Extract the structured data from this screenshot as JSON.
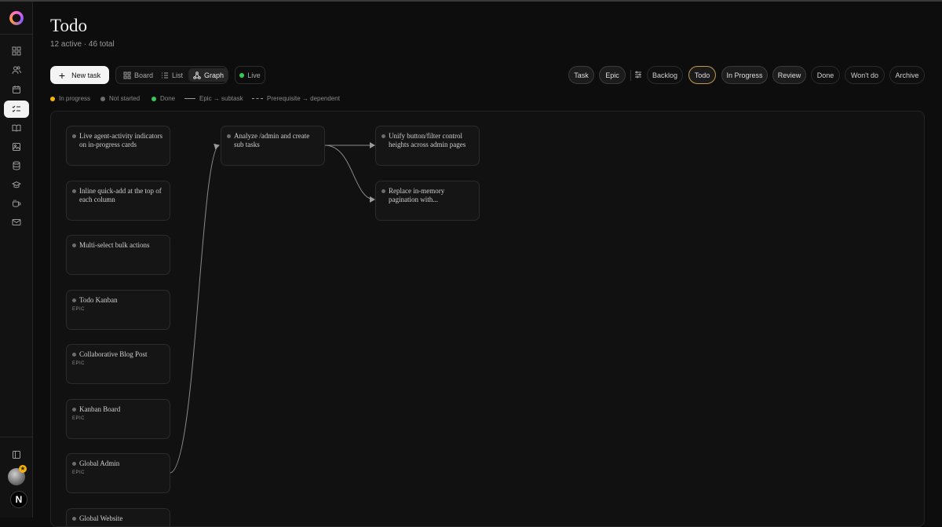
{
  "page": {
    "title": "Todo",
    "subtitle": "12 active · 46 total"
  },
  "sidebar": {
    "items": [
      {
        "icon": "dashboard-icon"
      },
      {
        "icon": "users-icon"
      },
      {
        "icon": "calendar-icon"
      },
      {
        "icon": "tasks-icon",
        "active": true
      },
      {
        "icon": "book-icon"
      },
      {
        "icon": "image-icon"
      },
      {
        "icon": "database-icon"
      },
      {
        "icon": "graduation-cap-icon"
      },
      {
        "icon": "coffee-cup-icon"
      },
      {
        "icon": "mail-icon"
      }
    ],
    "bottom": {
      "icon": "sidebar-toggle-icon",
      "avatar_badge": "★",
      "brand_letter": "N"
    }
  },
  "toolbar": {
    "new_task_label": "New task",
    "views": [
      {
        "label": "Board",
        "icon": "grid-icon"
      },
      {
        "label": "List",
        "icon": "list-icon"
      },
      {
        "label": "Graph",
        "icon": "graph-icon",
        "active": true
      }
    ],
    "live_label": "Live",
    "type_filters": [
      "Task",
      "Epic"
    ],
    "status_filters": [
      {
        "label": "Backlog"
      },
      {
        "label": "Todo",
        "selected": true
      },
      {
        "label": "In Progress"
      },
      {
        "label": "Review"
      },
      {
        "label": "Done"
      },
      {
        "label": "Won't do"
      },
      {
        "label": "Archive"
      }
    ]
  },
  "legend": {
    "in_progress": "In progress",
    "not_started": "Not started",
    "done": "Done",
    "epic_subtask": "Epic → subtask",
    "prereq_dependent": "Prerequisite → dependent",
    "colors": {
      "in_progress": "#f5b40a",
      "not_started": "#6c6c6c",
      "done": "#36c95a"
    }
  },
  "graph": {
    "nodes": [
      {
        "id": "live-agent",
        "title": "Live agent-activity indicators on in-progress cards",
        "epic": ""
      },
      {
        "id": "inline-quick-add",
        "title": "Inline quick-add at the top of each column",
        "epic": ""
      },
      {
        "id": "multi-select",
        "title": "Multi-select bulk actions",
        "epic": ""
      },
      {
        "id": "todo-kanban",
        "title": "Todo Kanban",
        "epic": "EPIC"
      },
      {
        "id": "collab-blog",
        "title": "Collaborative Blog Post",
        "epic": "EPIC"
      },
      {
        "id": "kanban-board",
        "title": "Kanban Board",
        "epic": "EPIC"
      },
      {
        "id": "global-admin",
        "title": "Global Admin",
        "epic": "EPIC"
      },
      {
        "id": "global-website",
        "title": "Global Website",
        "epic": ""
      },
      {
        "id": "analyze-admin",
        "title": "Analyze /admin and create sub tasks",
        "epic": ""
      },
      {
        "id": "unify-button",
        "title": "Unify button/filter control heights across admin pages",
        "epic": ""
      },
      {
        "id": "replace-pagination",
        "title": "Replace in-memory pagination with...",
        "epic": ""
      }
    ],
    "edges": [
      {
        "from": "global-admin",
        "to": "analyze-admin",
        "kind": "epic-subtask"
      },
      {
        "from": "analyze-admin",
        "to": "unify-button",
        "kind": "epic-subtask"
      },
      {
        "from": "analyze-admin",
        "to": "replace-pagination",
        "kind": "epic-subtask"
      }
    ]
  }
}
